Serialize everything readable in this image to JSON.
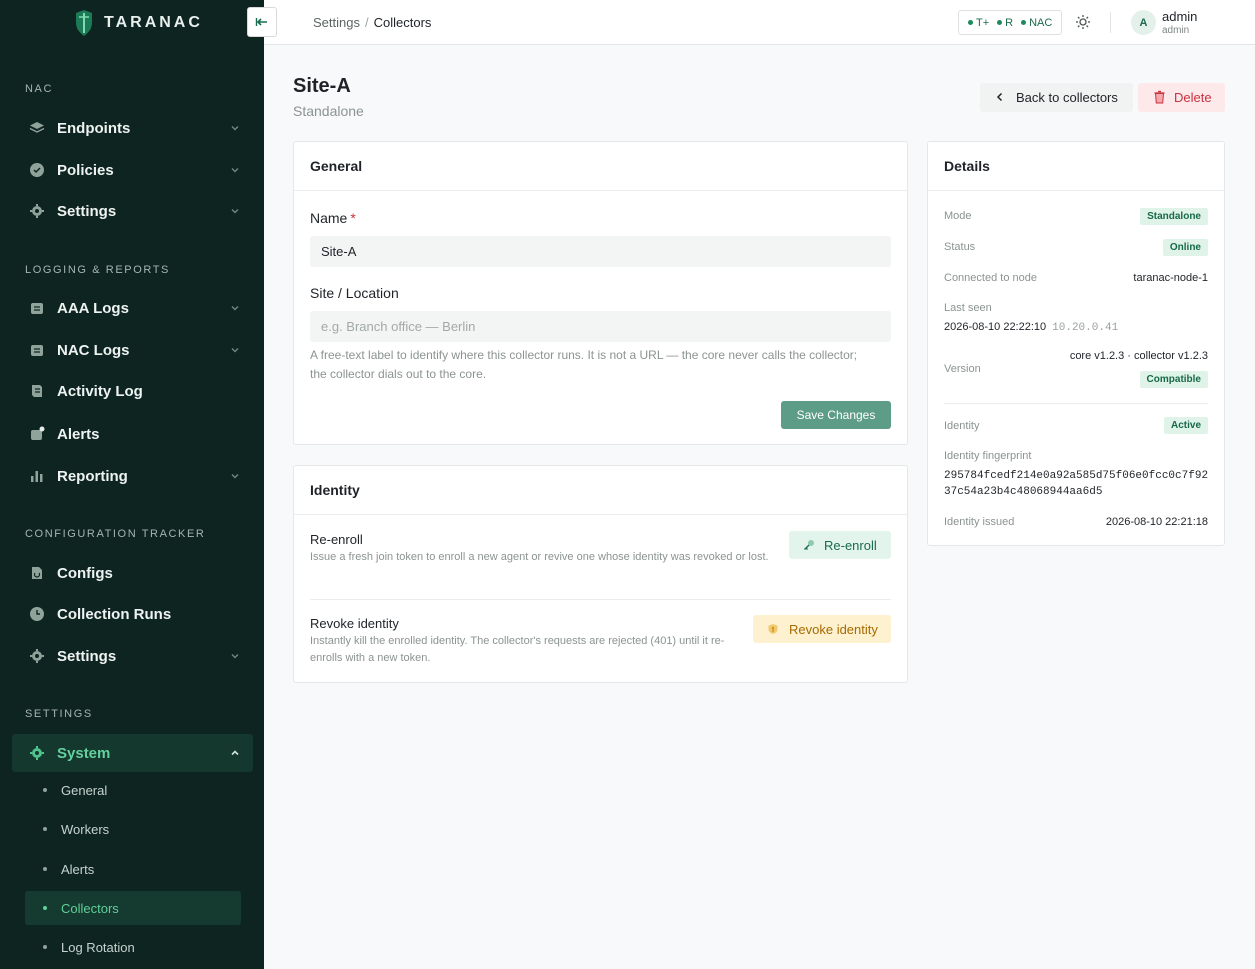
{
  "brand": {
    "name": "TARANAC"
  },
  "sidebar": {
    "sections": [
      {
        "label": "NAC",
        "items": [
          {
            "label": "Endpoints",
            "icon": "layers-icon",
            "has_chevron": true
          },
          {
            "label": "Policies",
            "icon": "shield-icon",
            "has_chevron": true
          },
          {
            "label": "Settings",
            "icon": "gear-icon",
            "has_chevron": true
          }
        ]
      },
      {
        "label": "LOGGING & REPORTS",
        "items": [
          {
            "label": "AAA Logs",
            "icon": "calendar-icon",
            "has_chevron": true
          },
          {
            "label": "NAC Logs",
            "icon": "calendar-icon",
            "has_chevron": true
          },
          {
            "label": "Activity Log",
            "icon": "scroll-icon",
            "has_chevron": false
          },
          {
            "label": "Alerts",
            "icon": "bell-icon",
            "has_chevron": false
          },
          {
            "label": "Reporting",
            "icon": "bar-chart-icon",
            "has_chevron": true
          }
        ]
      },
      {
        "label": "CONFIGURATION TRACKER",
        "items": [
          {
            "label": "Configs",
            "icon": "file-icon",
            "has_chevron": false
          },
          {
            "label": "Collection Runs",
            "icon": "clock-icon",
            "has_chevron": false
          },
          {
            "label": "Settings",
            "icon": "gear-icon",
            "has_chevron": true
          }
        ]
      },
      {
        "label": "SETTINGS",
        "items": [
          {
            "label": "System",
            "icon": "gear-icon",
            "has_chevron": true,
            "active": true
          }
        ]
      }
    ],
    "system_sub": [
      "General",
      "Workers",
      "Alerts",
      "Collectors",
      "Log Rotation"
    ],
    "active_sub": "Collectors"
  },
  "topbar": {
    "breadcrumb": [
      "Settings",
      "Collectors"
    ],
    "status": [
      "T+",
      "R",
      "NAC"
    ],
    "user": {
      "initial": "A",
      "name": "admin",
      "role": "admin"
    }
  },
  "page": {
    "title": "Site-A",
    "subtitle": "Standalone",
    "back_label": "Back to collectors",
    "delete_label": "Delete"
  },
  "general": {
    "title": "General",
    "name_label": "Name",
    "name_required": "*",
    "name_value": "Site-A",
    "site_label": "Site / Location",
    "site_placeholder": "e.g. Branch office — Berlin",
    "help_text": "A free-text label to identify where this collector runs. It is not a URL — the core never calls the collector; the collector dials out to the core.",
    "save_label": "Save Changes"
  },
  "identity": {
    "title": "Identity",
    "reenroll_title": "Re-enroll",
    "reenroll_desc": "Issue a fresh join token to enroll a new agent or revive one whose identity was revoked or lost.",
    "reenroll_label": "Re-enroll",
    "revoke_title": "Revoke identity",
    "revoke_desc": "Instantly kill the enrolled identity. The collector's requests are rejected (401) until it re-enrolls with a new token.",
    "revoke_label": "Revoke identity"
  },
  "details": {
    "title": "Details",
    "mode_label": "Mode",
    "mode_value": "Standalone",
    "status_label": "Status",
    "status_value": "Online",
    "node_label": "Connected to node",
    "node_value": "taranac-node-1",
    "last_seen_label": "Last seen",
    "last_seen_value": "2026-08-10 22:22:10",
    "last_seen_ip": "10.20.0.41",
    "version_label": "Version",
    "version_value": "core v1.2.3 · collector v1.2.3",
    "version_badge": "Compatible",
    "identity_label": "Identity",
    "identity_value": "Active",
    "fingerprint_label": "Identity fingerprint",
    "fingerprint_line1": "295784fcedf214e0a92a585d75f06e0fcc0c7f92",
    "fingerprint_line2": "37c54a23b4c48068944aa6d5",
    "issued_label": "Identity issued",
    "issued_value": "2026-08-10 22:21:18"
  },
  "colors": {
    "sidebar_bg": "#0e2420",
    "accent": "#1c6b4c",
    "danger": "#c8323f",
    "warning": "#a66a00"
  }
}
